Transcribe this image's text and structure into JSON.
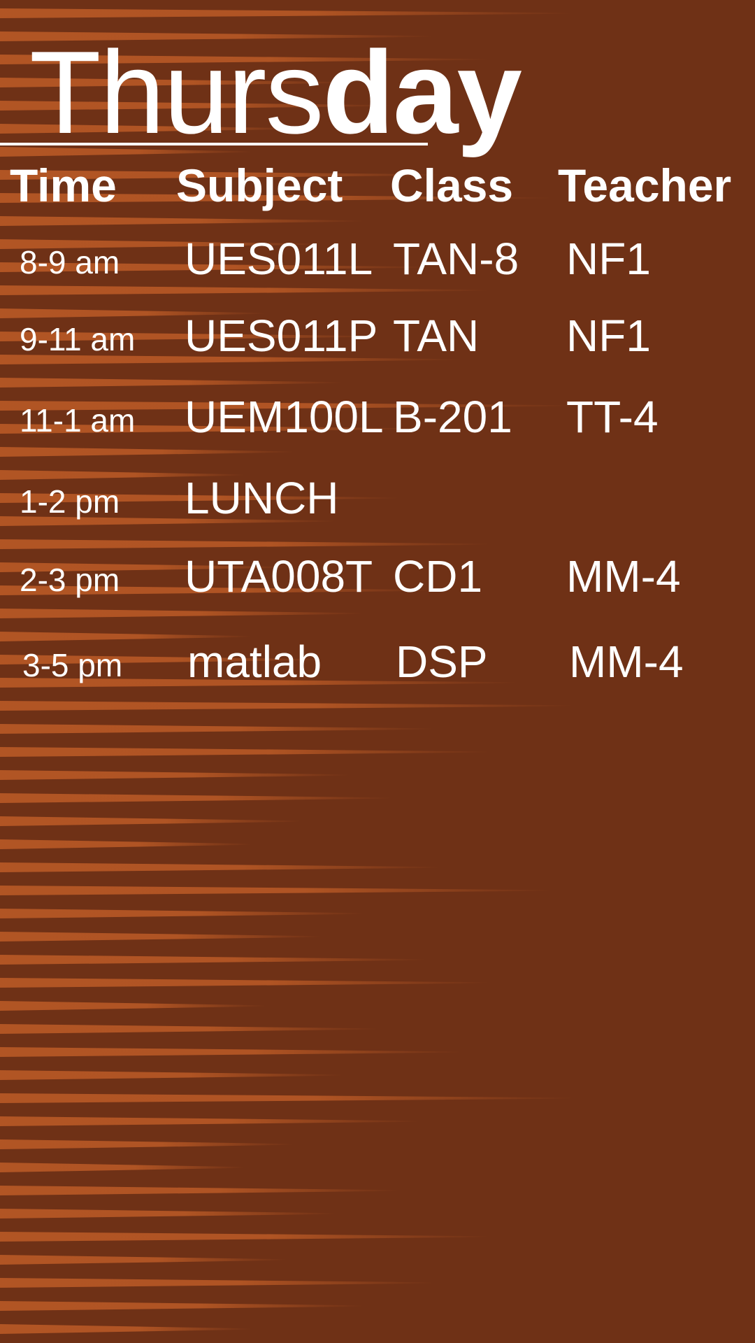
{
  "title": {
    "light": "Thurs",
    "bold": "day"
  },
  "headers": {
    "time": "Time",
    "subject": "Subject",
    "class": "Class",
    "teacher": "Teacher"
  },
  "rows": [
    {
      "time": "8-9 am",
      "subject": "UES011L",
      "class": "TAN-8",
      "teacher": "NF1"
    },
    {
      "time": "9-11 am",
      "subject": "UES011P",
      "class": "TAN",
      "teacher": "NF1"
    },
    {
      "time": "11-1 am",
      "subject": "UEM100L",
      "class": "B-201",
      "teacher": "TT-4"
    },
    {
      "time": "1-2 pm",
      "subject": "LUNCH",
      "class": "",
      "teacher": ""
    },
    {
      "time": "2-3 pm",
      "subject": "UTA008T",
      "class": "CD1",
      "teacher": "MM-4"
    },
    {
      "time": "3-5 pm",
      "subject": "matlab",
      "class": "DSP",
      "teacher": "MM-4"
    }
  ],
  "colors": {
    "background": "#6f3116",
    "stripe": "#b75825",
    "text": "#ffffff"
  }
}
